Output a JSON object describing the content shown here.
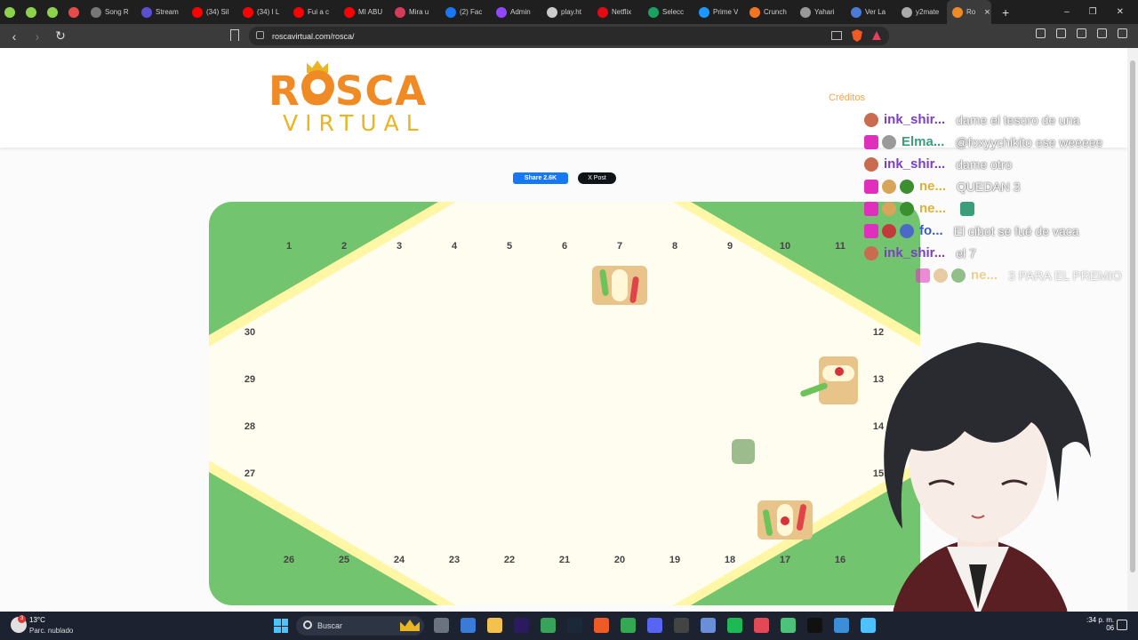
{
  "browser": {
    "tabs": [
      {
        "label": "",
        "color": "#8ed14b",
        "pinned": true
      },
      {
        "label": "",
        "color": "#8ed14b",
        "pinned": true
      },
      {
        "label": "",
        "color": "#8ed14b",
        "pinned": true
      },
      {
        "label": "",
        "color": "#e64a4a",
        "pinned": true
      },
      {
        "label": "Song R",
        "color": "#777777"
      },
      {
        "label": "Stream",
        "color": "#5a4fcf"
      },
      {
        "label": "(34) Sil",
        "color": "#ff0000"
      },
      {
        "label": "(34) I L",
        "color": "#ff0000"
      },
      {
        "label": "Fui a c",
        "color": "#ff0000"
      },
      {
        "label": "MI ABU",
        "color": "#ff0000"
      },
      {
        "label": "Mira u",
        "color": "#d63b5a"
      },
      {
        "label": "(2) Fac",
        "color": "#1877f2"
      },
      {
        "label": "Admin",
        "color": "#9146ff"
      },
      {
        "label": "play.ht",
        "color": "#cccccc"
      },
      {
        "label": "Netflix",
        "color": "#e50914"
      },
      {
        "label": "Selecc",
        "color": "#1aa260"
      },
      {
        "label": "Prime V",
        "color": "#1a98ff"
      },
      {
        "label": "Crunch",
        "color": "#f47521"
      },
      {
        "label": "Yahari",
        "color": "#999999"
      },
      {
        "label": "Ver La",
        "color": "#4a7bd6"
      },
      {
        "label": "y2mate",
        "color": "#aaaaaa"
      },
      {
        "label": "Ro",
        "color": "#f08a24",
        "active": true
      }
    ],
    "close_tab": "×",
    "new_tab": "+",
    "window_controls": {
      "minimize": "–",
      "maximize": "❐",
      "close": "✕"
    },
    "nav": {
      "back": "‹",
      "forward": "›",
      "reload": "↻"
    },
    "url": "roscavirtual.com/rosca/"
  },
  "site": {
    "logo_top": "ROSCA",
    "logo_bottom": "VIRTUAL",
    "credits_link": "Créditos",
    "share": {
      "facebook": "Share 2.6K",
      "x": "X Post"
    }
  },
  "board": {
    "top_positions": [
      "1",
      "2",
      "3",
      "4",
      "5",
      "6",
      "7",
      "8",
      "9",
      "10",
      "11"
    ],
    "right_positions": [
      "12",
      "13",
      "14",
      "15"
    ],
    "bottom_positions": [
      "26",
      "25",
      "24",
      "23",
      "22",
      "21",
      "20",
      "19",
      "18",
      "17",
      "16"
    ],
    "left_positions": [
      "30",
      "29",
      "28",
      "27"
    ],
    "colors": {
      "green": "#72c46e",
      "cream": "#fffdf0",
      "stripe": "#fff6a6"
    }
  },
  "chat": [
    {
      "user": "ink_shir...",
      "user_color": "#7a3fc2",
      "message": "dame el tesoro de una",
      "badges": [
        "#c96b4f"
      ]
    },
    {
      "user": "Elma...",
      "user_color": "#3a9e7a",
      "message": "@foxyychikito ese weeeee",
      "badges": [
        "#e12fbd",
        "#9a9a9a"
      ]
    },
    {
      "user": "ink_shir...",
      "user_color": "#7a3fc2",
      "message": "dame otro",
      "badges": [
        "#c96b4f"
      ]
    },
    {
      "user": "ne...",
      "user_color": "#d8b23a",
      "message": "QUEDAN 3",
      "badges": [
        "#e12fbd",
        "#d8a45a",
        "#3b8f2f"
      ]
    },
    {
      "user": "ne...",
      "user_color": "#d8b23a",
      "message": "",
      "badges": [
        "#e12fbd",
        "#d8a45a",
        "#3b8f2f"
      ]
    },
    {
      "user": "fo...",
      "user_color": "#3a5ac8",
      "message": "El cibot se fué de vaca",
      "badges": [
        "#e12fbd",
        "#c23b3b",
        "#4a6ac8"
      ]
    },
    {
      "user": "ink_shir...",
      "user_color": "#7a3fc2",
      "message": "el 7",
      "badges": [
        "#c96b4f"
      ]
    },
    {
      "user": "ne...",
      "user_color": "#d8b23a",
      "message": "3 PARA EL PREMIO",
      "badges": [
        "#e12fbd",
        "#d8a45a",
        "#3b8f2f"
      ]
    }
  ],
  "taskbar": {
    "temperature": "13°C",
    "condition": "Parc. nublado",
    "weather_badge": "3",
    "search_placeholder": "Buscar",
    "clock": ":34 p. m.",
    "date": "06"
  }
}
